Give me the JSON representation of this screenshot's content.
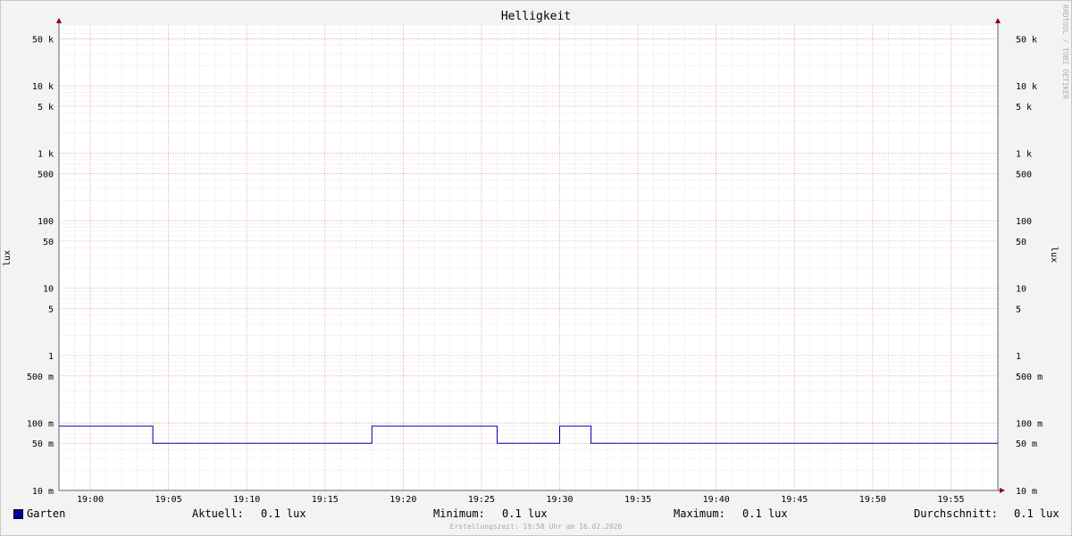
{
  "chart_data": {
    "type": "line",
    "title": "Helligkeit",
    "ylabel": "lux",
    "y_scale": "log",
    "ylim": [
      0.01,
      80000
    ],
    "y_ticks": [
      {
        "value": 50000,
        "label": "50 k"
      },
      {
        "value": 10000,
        "label": "10 k"
      },
      {
        "value": 5000,
        "label": "5 k"
      },
      {
        "value": 1000,
        "label": "1 k"
      },
      {
        "value": 500,
        "label": "500"
      },
      {
        "value": 100,
        "label": "100"
      },
      {
        "value": 50,
        "label": "50"
      },
      {
        "value": 10,
        "label": "10"
      },
      {
        "value": 5,
        "label": "5"
      },
      {
        "value": 1,
        "label": "1"
      },
      {
        "value": 0.5,
        "label": "500 m"
      },
      {
        "value": 0.1,
        "label": "100 m"
      },
      {
        "value": 0.05,
        "label": "50 m"
      },
      {
        "value": 0.01,
        "label": "10 m"
      }
    ],
    "xlim": [
      "18:58",
      "19:58"
    ],
    "x_ticks": [
      "19:00",
      "19:05",
      "19:10",
      "19:15",
      "19:20",
      "19:25",
      "19:30",
      "19:35",
      "19:40",
      "19:45",
      "19:50",
      "19:55"
    ],
    "grid": true,
    "series": [
      {
        "name": "Garten",
        "color": "#0000a0",
        "points": [
          [
            "18:58",
            0.09
          ],
          [
            "19:04",
            0.09
          ],
          [
            "19:04",
            0.05
          ],
          [
            "19:18",
            0.05
          ],
          [
            "19:18",
            0.09
          ],
          [
            "19:26",
            0.09
          ],
          [
            "19:26",
            0.05
          ],
          [
            "19:30",
            0.05
          ],
          [
            "19:30",
            0.09
          ],
          [
            "19:32",
            0.09
          ],
          [
            "19:32",
            0.05
          ],
          [
            "19:58",
            0.05
          ]
        ]
      }
    ]
  },
  "legend": {
    "series_name": "Garten",
    "current_label": "Aktuell:",
    "current_value": "0.1 lux",
    "min_label": "Minimum:",
    "min_value": "0.1 lux",
    "max_label": "Maximum:",
    "max_value": "0.1 lux",
    "avg_label": "Durchschnitt:",
    "avg_value": "0.1 lux"
  },
  "footer": "Erstellungszeit: 19:58 Uhr am 16.02.2026",
  "watermark": "RRDTOOL / TOBI OETIKER"
}
